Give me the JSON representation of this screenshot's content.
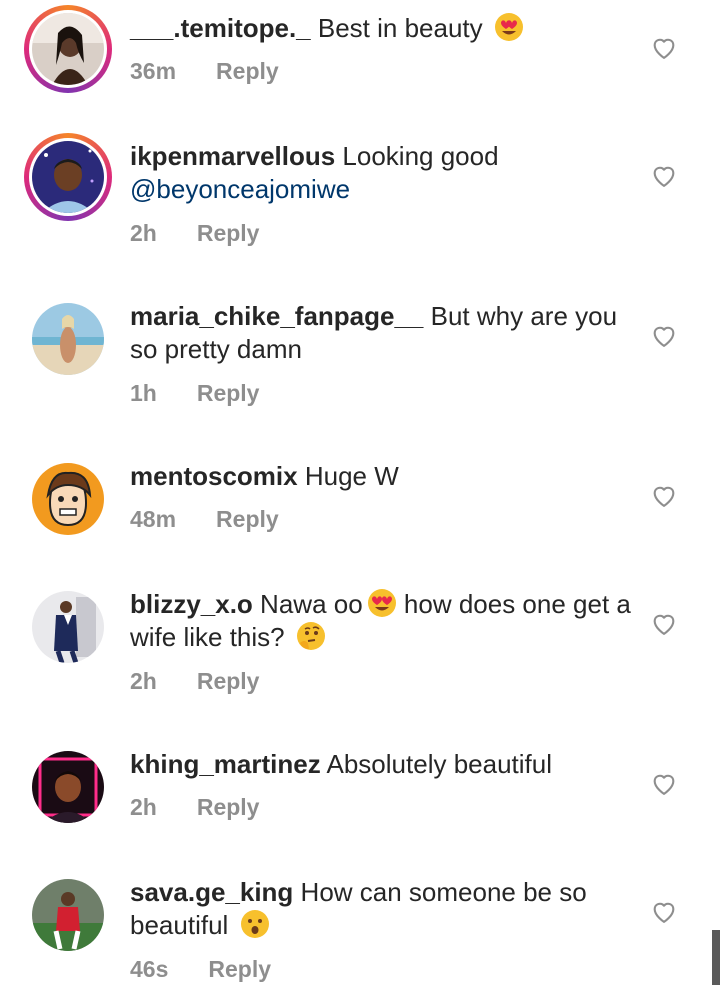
{
  "comments": [
    {
      "user": "___.temitope._",
      "text": " Best in beauty ",
      "time": "36m",
      "reply": "Reply",
      "emoji": "heart-eyes-emoji",
      "avatar": "woman-portrait",
      "story": true
    },
    {
      "user": "ikpenmarvellous",
      "text": " Looking good ",
      "mention": "@beyonceajomiwe",
      "time": "2h",
      "reply": "Reply",
      "avatar": "cartoon-boy-portrait",
      "story": true
    },
    {
      "user": "maria_chike_fanpage__",
      "text": " But why are you so pretty damn",
      "time": "1h",
      "reply": "Reply",
      "avatar": "beach-photo",
      "story": false
    },
    {
      "user": "mentoscomix",
      "text": " Huge W",
      "time": "48m",
      "reply": "Reply",
      "avatar": "comic-character",
      "story": false
    },
    {
      "user": "blizzy_x.o",
      "text": " Nawa oo",
      "text2": " how does one get a wife like this? ",
      "time": "2h",
      "reply": "Reply",
      "emoji": "heart-eyes-emoji",
      "emoji2": "thinking-face-emoji",
      "avatar": "man-suit-photo",
      "story": false
    },
    {
      "user": "khing_martinez",
      "text": " Absolutely beautiful",
      "time": "2h",
      "reply": "Reply",
      "avatar": "neon-portrait",
      "story": false
    },
    {
      "user": "sava.ge_king",
      "text": " How can someone be so beautiful ",
      "time": "46s",
      "reply": "Reply",
      "emoji": "astonished-face-emoji",
      "avatar": "footballer-photo",
      "story": false
    }
  ],
  "colors": {
    "text": "#262626",
    "meta": "#8e8e8e",
    "mention": "#00376b",
    "background": "#ffffff"
  },
  "icons": {
    "like": "heart-outline-icon"
  }
}
